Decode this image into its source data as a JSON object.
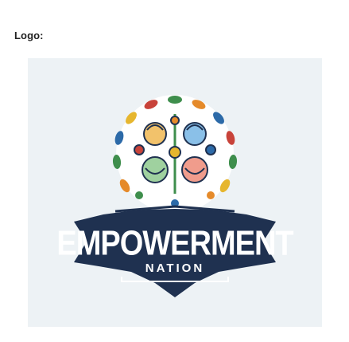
{
  "label": "Logo:",
  "logo": {
    "name": "empowerment-nation-logo",
    "main_text": "EMPOWERMENT",
    "sub_text": "NATION",
    "colors": {
      "background_panel": "#edf2f5",
      "badge_dark": "#1f3150",
      "text": "#ffffff",
      "green": "#3e8e4c",
      "orange": "#e58a2a",
      "blue": "#2c6aa8",
      "red": "#c8433a",
      "yellow": "#e6b62e"
    }
  }
}
